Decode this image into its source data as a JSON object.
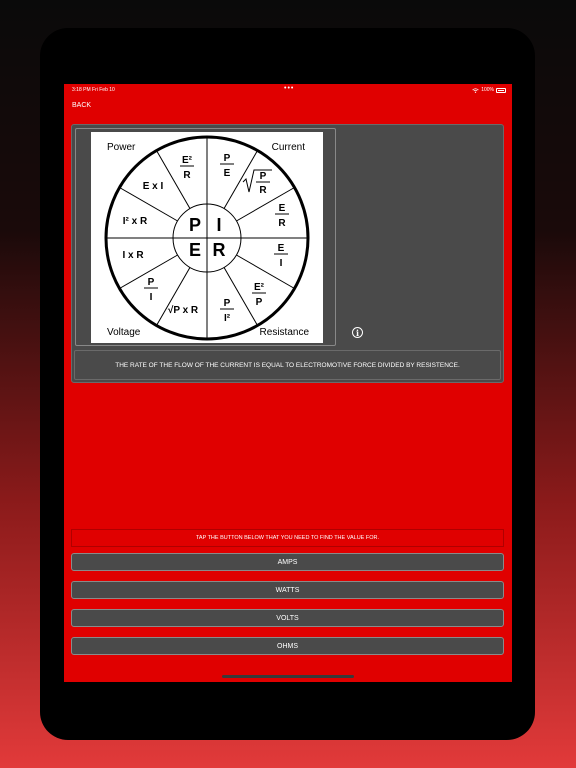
{
  "status_bar": {
    "time_date": "3:18 PM  Fri Feb 10",
    "center_dots": "•••",
    "battery": "100%"
  },
  "nav": {
    "back_label": "BACK"
  },
  "diagram": {
    "corner_power": "Power",
    "corner_current": "Current",
    "corner_voltage": "Voltage",
    "corner_resistance": "Resistance",
    "center_p": "P",
    "center_i": "I",
    "center_e": "E",
    "center_r": "R",
    "formula_e_times_i": "E x I",
    "formula_i2_times_r": "I² x R",
    "formula_i_times_r": "I x R",
    "formula_sqrt_p_times_r": "√P x R",
    "num_e2_r": "E²",
    "den_e2_r": "R",
    "num_p_e": "P",
    "den_p_e": "E",
    "num_sqrt_p_r": "P",
    "den_sqrt_p_r": "R",
    "num_e_r": "E",
    "den_e_r": "R",
    "num_e_i": "E",
    "den_e_i": "I",
    "num_e2_p": "E²",
    "den_e2_p": "P",
    "num_p_i2": "P",
    "den_p_i2": "I²",
    "num_p_i": "P",
    "den_p_i": "I"
  },
  "description": "THE RATE OF THE FLOW OF THE CURRENT IS EQUAL TO ELECTROMOTIVE FORCE DIVIDED BY RESISTENCE.",
  "prompt": "TAP THE BUTTON BELOW THAT YOU NEED TO FIND THE VALUE FOR.",
  "buttons": {
    "amps": "AMPS",
    "watts": "WATTS",
    "volts": "VOLTS",
    "ohms": "OHMS"
  },
  "colors": {
    "screen_bg": "#e00000",
    "panel_bg": "#4a4a4a"
  }
}
